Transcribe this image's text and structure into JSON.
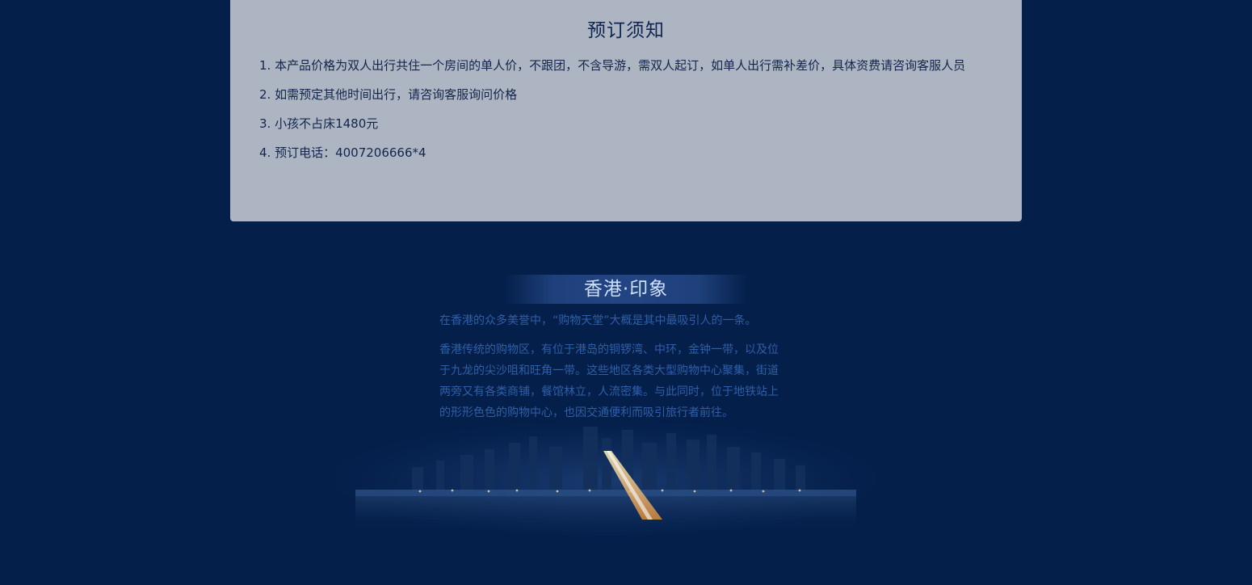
{
  "notice": {
    "title": "预订须知",
    "items": [
      "1. 本产品价格为双人出行共住一个房间的单人价，不跟团，不含导游，需双人起订，如单人出行需补差价，具体资费请咨询客服人员",
      "2. 如需预定其他时间出行，请咨询客服询问价格",
      "3. 小孩不占床1480元",
      "4. 预订电话：4007206666*4"
    ]
  },
  "impression": {
    "title": "香港·印象",
    "line1": "在香港的众多美誉中，“购物天堂”大概是其中最吸引人的一条。",
    "para2_lines": [
      "香港传统的购物区，有位于港岛的铜锣湾、中环，金钟一带，以及位",
      "于九龙的尖沙咀和旺角一带。这些地区各类大型购物中心聚集，街道",
      "两旁又有各类商铺，餐馆林立，人流密集。与此同时，位于地铁站上",
      "的形形色色的购物中心，也因交通便利而吸引旅行者前往。"
    ]
  },
  "colors": {
    "page_background": "#041f4a",
    "notice_background": "#adb5c3",
    "notice_text": "#12264b",
    "impression_text": "#2f5fa8",
    "impression_title": "#cfe0ff"
  }
}
